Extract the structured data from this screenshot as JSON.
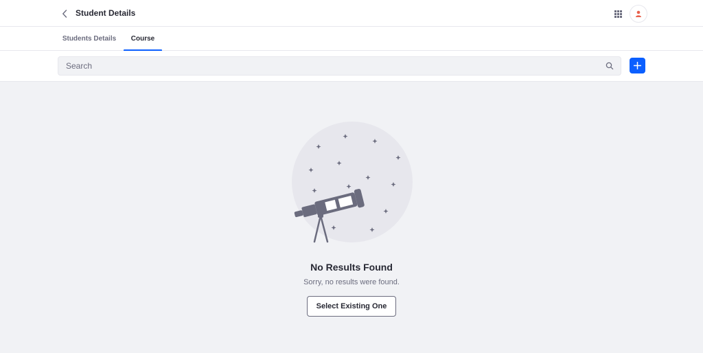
{
  "header": {
    "title": "Student Details",
    "back_icon": "chevron-left-icon",
    "apps_icon": "apps-grid-icon",
    "avatar_icon": "user-icon"
  },
  "tabs": [
    {
      "label": "Students Details",
      "active": false
    },
    {
      "label": "Course",
      "active": true
    }
  ],
  "search": {
    "placeholder": "Search",
    "value": "",
    "icon": "search-icon",
    "add_icon": "plus-icon"
  },
  "empty_state": {
    "illustration": "telescope-stars-illustration",
    "title": "No Results Found",
    "description": "Sorry, no results were found.",
    "action_label": "Select Existing One"
  },
  "colors": {
    "accent": "#0b5fff",
    "background": "#f1f2f5",
    "avatar_icon": "#e8604c",
    "illustration_circle": "#e7e7ed",
    "illustration_ink": "#6b6c7e"
  }
}
